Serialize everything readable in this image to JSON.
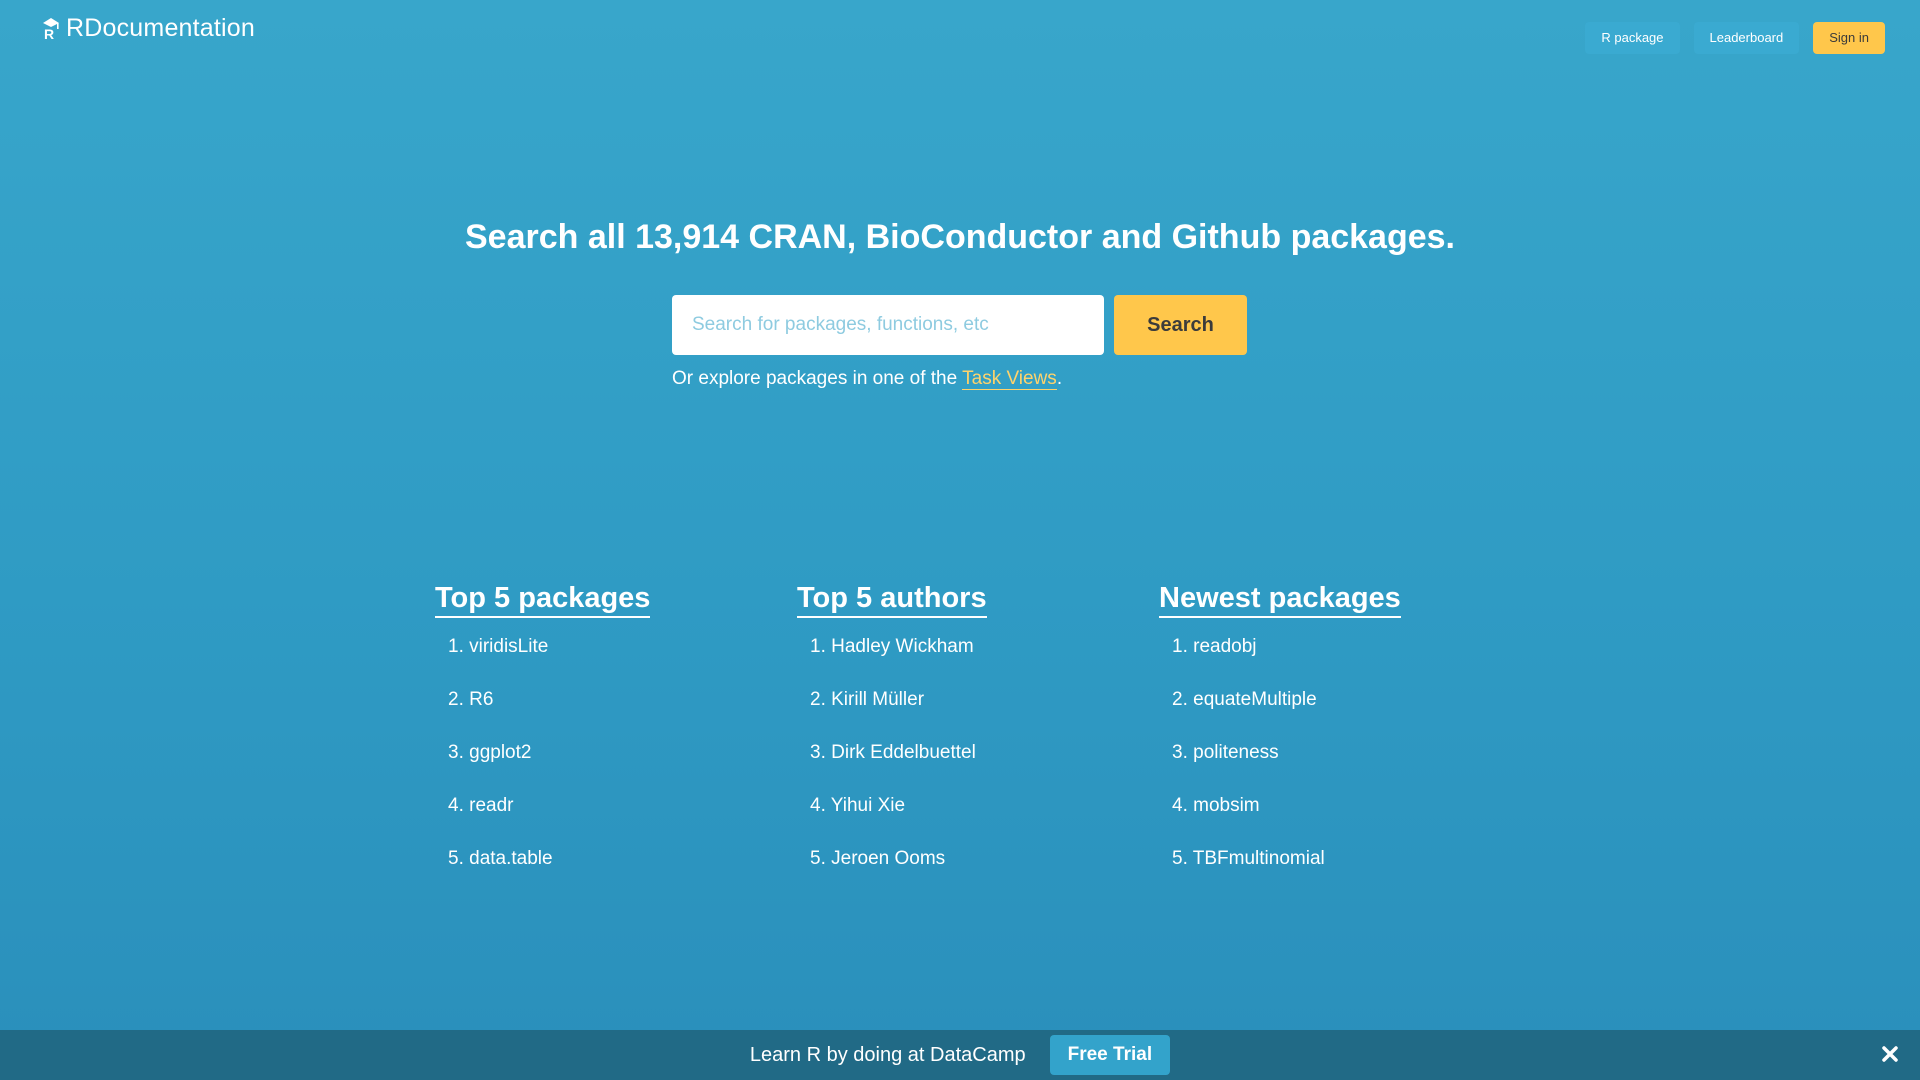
{
  "header": {
    "logo_text": "RDocumentation",
    "nav": {
      "r_package": "R package",
      "leaderboard": "Leaderboard",
      "sign_in": "Sign in"
    }
  },
  "hero": {
    "title": "Search all 13,914 CRAN, BioConductor and Github packages.",
    "search_placeholder": "Search for packages, functions, etc",
    "search_button": "Search",
    "explore_prefix": "Or explore packages in one of the ",
    "explore_link": "Task Views",
    "explore_suffix": "."
  },
  "lists": {
    "top_packages": {
      "title": "Top 5 packages",
      "items": [
        "1. viridisLite",
        "2. R6",
        "3. ggplot2",
        "4. readr",
        "5. data.table"
      ]
    },
    "top_authors": {
      "title": "Top 5 authors",
      "items": [
        "1. Hadley Wickham",
        "2. Kirill Müller",
        "3. Dirk Eddelbuettel",
        "4. Yihui Xie",
        "5. Jeroen Ooms"
      ]
    },
    "newest_packages": {
      "title": "Newest packages",
      "items": [
        "1. readobj",
        "2. equateMultiple",
        "3. politeness",
        "4. mobsim",
        "5. TBFmultinomial"
      ]
    }
  },
  "footer": {
    "text": "Learn R by doing at DataCamp",
    "trial_button": "Free Trial"
  },
  "colors": {
    "background": "#2f9bc4",
    "accent": "#ffc74b",
    "footer": "#216a86"
  },
  "icons": {
    "logo": "graduation-cap-r-icon",
    "close": "close-icon"
  }
}
